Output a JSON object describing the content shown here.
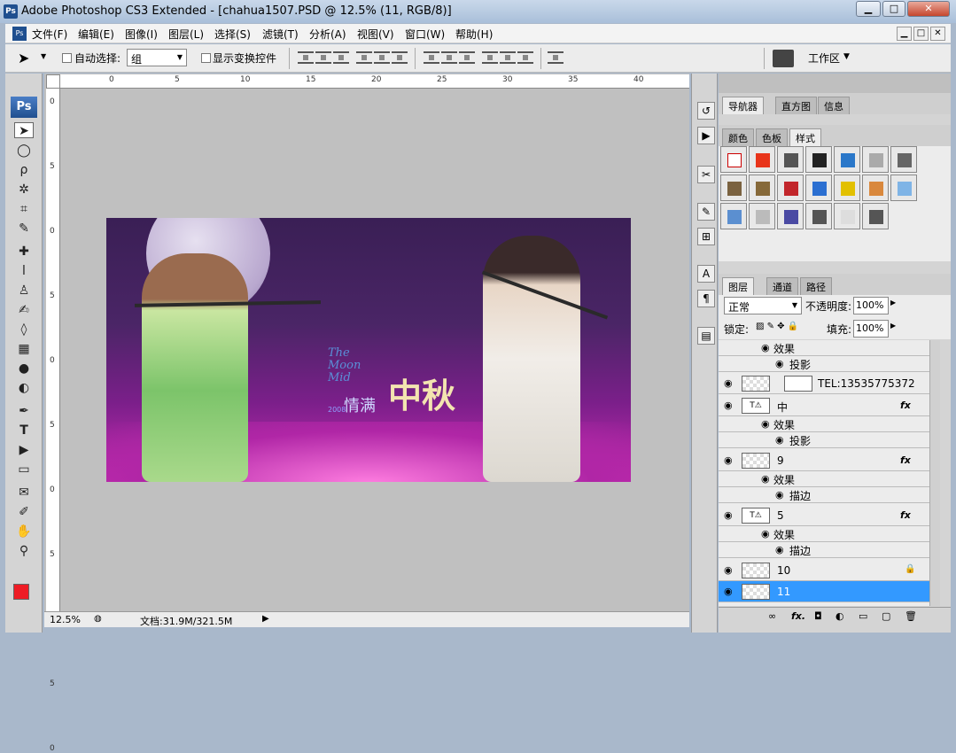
{
  "window": {
    "title": "Adobe Photoshop CS3 Extended - [chahua1507.PSD @ 12.5% (11, RGB/8)]",
    "app_badge": "Ps"
  },
  "window_buttons": {
    "minimize": "▁",
    "maximize": "□",
    "close": "✕"
  },
  "menu": [
    "文件(F)",
    "编辑(E)",
    "图像(I)",
    "图层(L)",
    "选择(S)",
    "滤镜(T)",
    "分析(A)",
    "视图(V)",
    "窗口(W)",
    "帮助(H)"
  ],
  "options": {
    "auto_select_label": "自动选择:",
    "auto_select_value": "组",
    "show_transform_label": "显示变换控件",
    "workspace_label": "工作区"
  },
  "ruler": {
    "top_ticks": [
      "0",
      "5",
      "10",
      "15",
      "20",
      "25",
      "30",
      "35",
      "40"
    ],
    "left_ticks": [
      "0",
      "5",
      "0",
      "5",
      "0",
      "5",
      "0",
      "5",
      "0",
      "5",
      "0"
    ]
  },
  "status": {
    "zoom": "12.5%",
    "doc_info": "文档:31.9M/321.5M"
  },
  "panels": {
    "nav_tabs": [
      "导航器",
      "直方图",
      "信息"
    ],
    "style_tabs": [
      "颜色",
      "色板",
      "样式"
    ],
    "layer_tabs": [
      "图层",
      "通道",
      "路径"
    ],
    "blend_mode": "正常",
    "opacity_label": "不透明度:",
    "opacity_value": "100%",
    "lock_label": "锁定:",
    "fill_label": "填充:",
    "fill_value": "100%"
  },
  "canvas_text": {
    "moon": "The Moon Mid",
    "title": "中秋",
    "sub": "情满",
    "year": "2008"
  },
  "layers": [
    {
      "type": "sub",
      "label": "效果"
    },
    {
      "type": "subsub",
      "label": "投影"
    },
    {
      "type": "layer",
      "label": "TEL:13535775372"
    },
    {
      "type": "layer",
      "label": "中",
      "fx": "fx"
    },
    {
      "type": "sub",
      "label": "效果"
    },
    {
      "type": "subsub",
      "label": "投影"
    },
    {
      "type": "layer",
      "label": "9",
      "fx": "fx"
    },
    {
      "type": "sub",
      "label": "效果"
    },
    {
      "type": "subsub",
      "label": "描边"
    },
    {
      "type": "layer",
      "label": "5",
      "fx": "fx"
    },
    {
      "type": "sub",
      "label": "效果"
    },
    {
      "type": "subsub",
      "label": "描边"
    },
    {
      "type": "layer",
      "label": "10"
    },
    {
      "type": "layer",
      "label": "11",
      "selected": true
    }
  ],
  "colors": {
    "foreground": "#ee1c25",
    "background": "#ffffff",
    "selection": "#3399ff"
  }
}
